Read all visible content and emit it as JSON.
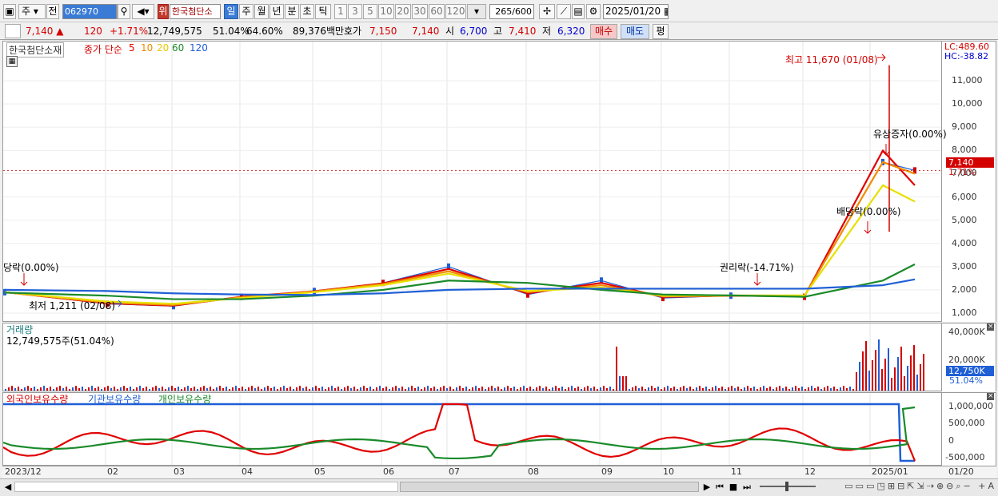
{
  "toolbar": {
    "type_label": "주",
    "prev_label": "전",
    "code": "062970",
    "name": "한국첨단소",
    "name_badge": "위",
    "periods": [
      "일",
      "주",
      "월",
      "년",
      "분",
      "초",
      "틱"
    ],
    "minute_steps": [
      "1",
      "3",
      "5",
      "10",
      "20",
      "30",
      "60",
      "120"
    ],
    "count": "265",
    "count_max": "/600",
    "date": "2025/01/20"
  },
  "quote": {
    "price": "7,140",
    "arrow": "▲",
    "change": "120",
    "change_pct": "+1.71%",
    "volume": "12,749,575",
    "vol_ratio": "51.04%",
    "turnover": "64.60%",
    "amount": "89,376백만",
    "hoga_label": "호가",
    "ask": "7,150",
    "bid": "7,140",
    "open_label": "시",
    "open": "6,700",
    "high_label": "고",
    "high": "7,410",
    "low_label": "저",
    "low": "6,320",
    "buy": "매수",
    "sell": "매도",
    "avg": "평"
  },
  "price_pane": {
    "name": "한국첨단소재",
    "legend_prefix": "종가 단순",
    "ma": [
      {
        "label": "5",
        "color": "#e00000"
      },
      {
        "label": "10",
        "color": "#f08c00"
      },
      {
        "label": "20",
        "color": "#e8e000"
      },
      {
        "label": "60",
        "color": "#1a8a2a"
      },
      {
        "label": "120",
        "color": "#1f5fd6"
      }
    ],
    "lc": "LC:489.60",
    "hc": "HC:-38.82",
    "annotations": {
      "high": "최고 11,670 (01/08)",
      "low": "최저 1,211 (02/08)",
      "rights": "권리락(-14.71%)",
      "dividend": "배당락(0.00%)",
      "bonus": "유상증자(0.00%)",
      "left": "당락(0.00%)"
    },
    "price_tag": "7,140",
    "pct_tag": "1.71%",
    "yticks": [
      "11,000",
      "10,000",
      "9,000",
      "8,000",
      "7,000",
      "6,000",
      "5,000",
      "4,000",
      "3,000",
      "2,000",
      "1,000"
    ]
  },
  "volume_pane": {
    "title": "거래량",
    "info": "12,749,575주(51.04%)",
    "yticks": [
      "40,000K",
      "20,000K"
    ],
    "tag": "12,750K",
    "tag_pct": "51.04%"
  },
  "holding_pane": {
    "foreign": "외국인보유수량",
    "institution": "기관보유수량",
    "individual": "개인보유수량",
    "yticks": [
      "1,000,000",
      "500,000",
      "0",
      "-500,000"
    ]
  },
  "xaxis": [
    "2023/12",
    "02",
    "03",
    "04",
    "05",
    "06",
    "07",
    "08",
    "09",
    "10",
    "11",
    "12",
    "2025/01",
    "01/20"
  ],
  "chart_data": {
    "type": "line",
    "title": "한국첨단소재",
    "x": [
      "2023/12",
      "02",
      "03",
      "04",
      "05",
      "06",
      "07",
      "08",
      "09",
      "10",
      "11",
      "12",
      "2025/01",
      "01/20"
    ],
    "series": [
      {
        "name": "종가",
        "values": [
          1900,
          1400,
          1300,
          1700,
          1950,
          2300,
          3000,
          1800,
          2400,
          1650,
          1750,
          1700,
          7500,
          7140
        ]
      },
      {
        "name": "5",
        "values": [
          1900,
          1420,
          1320,
          1700,
          1940,
          2280,
          2900,
          1850,
          2300,
          1700,
          1750,
          1720,
          8000,
          6500
        ]
      },
      {
        "name": "10",
        "values": [
          1900,
          1450,
          1350,
          1680,
          1930,
          2250,
          2800,
          1900,
          2200,
          1720,
          1750,
          1740,
          7500,
          7000
        ]
      },
      {
        "name": "20",
        "values": [
          1900,
          1500,
          1400,
          1650,
          1900,
          2200,
          2700,
          1950,
          2100,
          1750,
          1760,
          1760,
          6500,
          5800
        ]
      },
      {
        "name": "60",
        "values": [
          1880,
          1750,
          1600,
          1600,
          1750,
          2000,
          2400,
          2300,
          2000,
          1800,
          1760,
          1700,
          2400,
          3100
        ]
      },
      {
        "name": "120",
        "values": [
          2000,
          1950,
          1850,
          1800,
          1780,
          1850,
          2000,
          2050,
          2050,
          2050,
          2050,
          2050,
          2200,
          2450
        ]
      }
    ],
    "ylim": [
      1000,
      12000
    ]
  },
  "colors": {
    "up": "#d40000",
    "down": "#1f5fd6",
    "accent": "#3a7bd5"
  }
}
